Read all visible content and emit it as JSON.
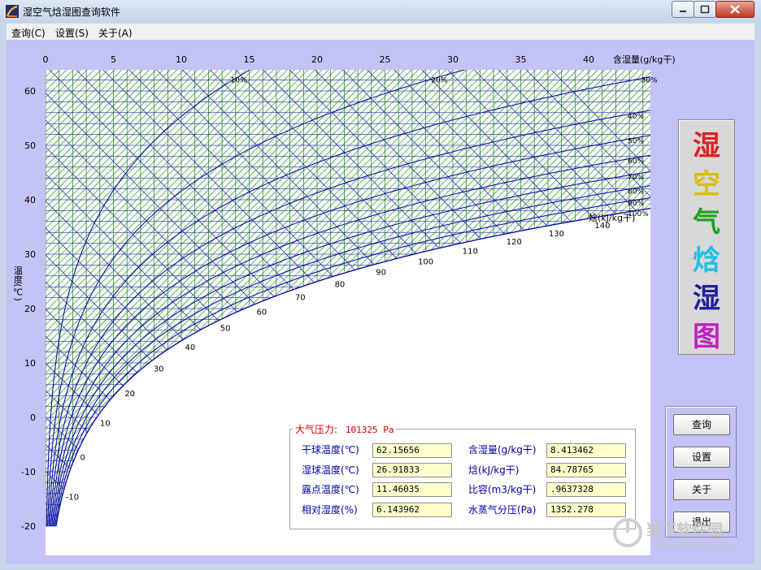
{
  "window": {
    "title": "湿空气焓湿图查询软件"
  },
  "menu": [
    {
      "label": "查询(C)"
    },
    {
      "label": "设置(S)"
    },
    {
      "label": "关于(A)"
    }
  ],
  "colors": {
    "grid": "#2a7a2a",
    "curves": "#0000aa",
    "background": "#c3c3f7",
    "value_bg": "#ffffcc"
  },
  "chart_data": {
    "type": "psychrometric",
    "x_axis": {
      "label": "含湿量(g/kg干)",
      "range": [
        0,
        40
      ],
      "ticks": [
        0,
        5,
        10,
        15,
        20,
        25,
        30,
        35,
        40
      ]
    },
    "y_axis": {
      "label": "温度(℃)",
      "range": [
        -20,
        60
      ],
      "ticks": [
        60,
        50,
        40,
        30,
        20,
        10,
        0,
        -10,
        -20
      ]
    },
    "rh_curves": {
      "unit_suffix": "%",
      "values": [
        10,
        20,
        30,
        40,
        50,
        60,
        70,
        80,
        90,
        100
      ],
      "labels": [
        "10%",
        "20%",
        "30%",
        "40%",
        "50%",
        "60%",
        "70%",
        "80%",
        "90%",
        "100%"
      ]
    },
    "enthalpy": {
      "axis_label": "焓(kJ/kg干)",
      "ticks": [
        "-10",
        "0",
        "10",
        "20",
        "30",
        "40",
        "50",
        "60",
        "70",
        "80",
        "90",
        "100",
        "110",
        "120",
        "130",
        "140"
      ]
    },
    "hatch_region": "unsaturated-zone"
  },
  "logo": {
    "chars": [
      "湿",
      "空",
      "气",
      "焓",
      "湿",
      "图"
    ],
    "colors": [
      "#e02020",
      "#d8c000",
      "#20a020",
      "#20c0e0",
      "#2020a0",
      "#c020c0"
    ]
  },
  "side_buttons": [
    {
      "label": "查询"
    },
    {
      "label": "设置"
    },
    {
      "label": "关于"
    },
    {
      "label": "退出"
    }
  ],
  "info": {
    "pressure_label": "大气压力:",
    "pressure_value": "101325 Pa",
    "fields_left": [
      {
        "label": "干球温度(℃)",
        "value": "62.15656"
      },
      {
        "label": "湿球温度(℃)",
        "value": "26.91833"
      },
      {
        "label": "露点温度(℃)",
        "value": "11.46035"
      },
      {
        "label": "相对湿度(%)",
        "value": "6.143962"
      }
    ],
    "fields_right": [
      {
        "label": "含湿量(g/kg干)",
        "value": "8.413462"
      },
      {
        "label": "焓(kJ/kg干)",
        "value": "84.78765"
      },
      {
        "label": "比容(m3/kg干)",
        "value": ".9637328"
      },
      {
        "label": "水蒸气分压(Pa)",
        "value": "1352.278"
      }
    ]
  },
  "watermark": {
    "text": "当下软件园",
    "url": "www.downxia.com"
  }
}
